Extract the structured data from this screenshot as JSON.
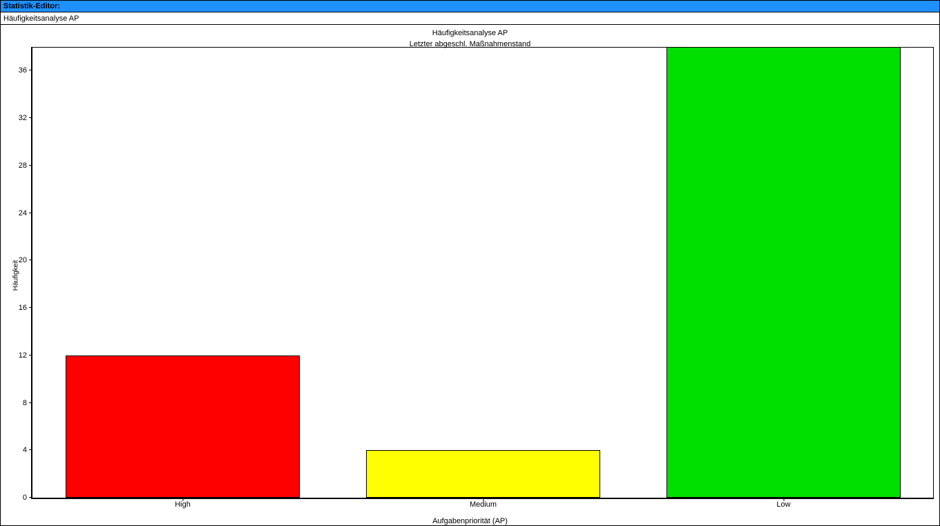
{
  "window": {
    "title": "Statistik-Editor:"
  },
  "breadcrumb": {
    "text": "Häufigkeitsanalyse AP"
  },
  "chart_data": {
    "type": "bar",
    "title": "Häufigkeitsanalyse AP",
    "subtitle": "Letzter abgeschl. Maßnahmenstand",
    "xlabel": "Aufgabenpriorität (AP)",
    "ylabel": "Häufigkeit",
    "categories": [
      "High",
      "Medium",
      "Low"
    ],
    "values": [
      12,
      4,
      38
    ],
    "colors": [
      "#ff0000",
      "#ffff00",
      "#00e000"
    ],
    "ylim": [
      0,
      38
    ],
    "yticks": [
      0,
      4,
      8,
      12,
      16,
      20,
      24,
      28,
      32,
      36
    ]
  }
}
